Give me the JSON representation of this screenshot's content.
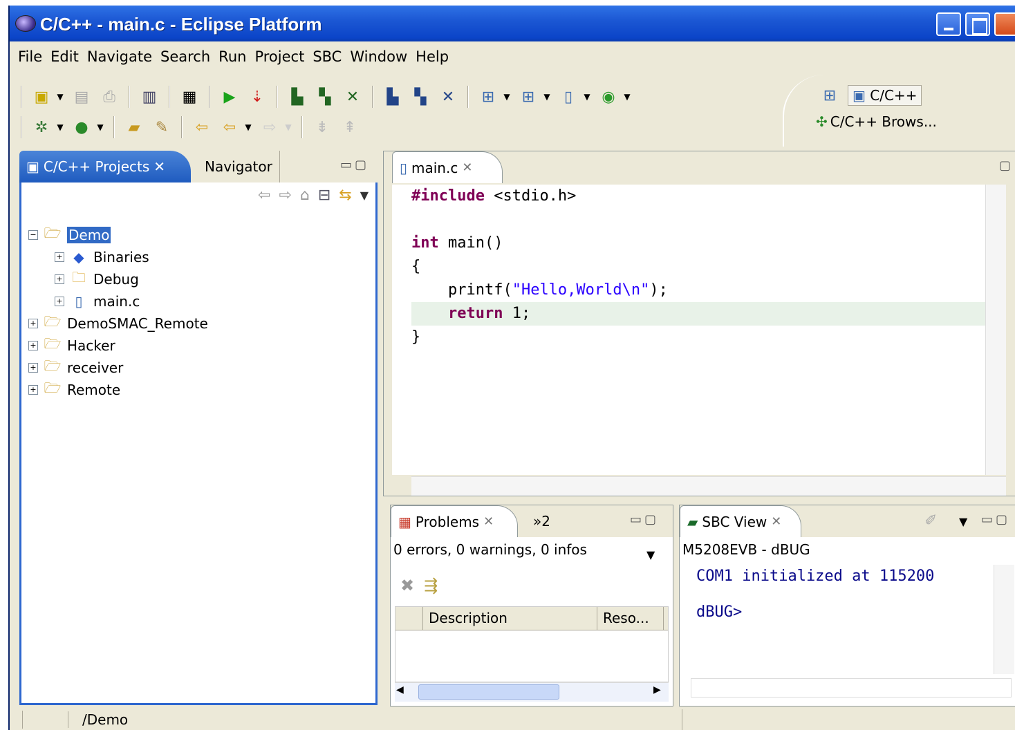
{
  "window": {
    "title": "C/C++ - main.c - Eclipse Platform"
  },
  "menu": [
    "File",
    "Edit",
    "Navigate",
    "Search",
    "Run",
    "Project",
    "SBC",
    "Window",
    "Help"
  ],
  "perspectives": {
    "active": "C/C++",
    "other": "C/C++ Brows..."
  },
  "projects_view": {
    "tab_label": "C/C++ Projects",
    "other_tab": "Navigator",
    "tree": [
      {
        "label": "Demo",
        "expanded": true,
        "selected": true,
        "level": 0,
        "icon": "c-project-folder-icon"
      },
      {
        "label": "Binaries",
        "level": 1,
        "icon": "binaries-diamond-icon"
      },
      {
        "label": "Debug",
        "level": 1,
        "icon": "folder-icon"
      },
      {
        "label": "main.c",
        "level": 1,
        "icon": "c-file-icon"
      },
      {
        "label": "DemoSMAC_Remote",
        "level": 0,
        "icon": "c-project-folder-icon"
      },
      {
        "label": "Hacker",
        "level": 0,
        "icon": "c-project-folder-icon"
      },
      {
        "label": "receiver",
        "level": 0,
        "icon": "c-project-folder-icon"
      },
      {
        "label": "Remote",
        "level": 0,
        "icon": "c-project-folder-icon"
      }
    ]
  },
  "editor": {
    "tab_label": "main.c",
    "code": {
      "line1_kw": "#include",
      "line1_rest": " <stdio.h>",
      "line3_kw": "int",
      "line3_rest": " main()",
      "line4": "{",
      "line5_pre": "    printf(",
      "line5_str": "\"Hello,World\\n\"",
      "line5_post": ");",
      "line6_pre": "    ",
      "line6_kw": "return",
      "line6_rest": " 1;",
      "line7": "}"
    }
  },
  "problems": {
    "tab_label": "Problems",
    "overflow_label": "»2",
    "summary": "0 errors, 0 warnings, 0 infos",
    "columns": [
      "Description",
      "Reso..."
    ]
  },
  "sbc_view": {
    "tab_label": "SBC View",
    "board": "M5208EVB - dBUG",
    "terminal_line1": "COM1 initialized at 115200",
    "terminal_line2": "dBUG>"
  },
  "status": {
    "path": "/Demo"
  },
  "colors": {
    "accent": "#316ac5",
    "keyword": "#7f0055",
    "string": "#2a00ff",
    "title_blue": "#0b44c8"
  }
}
